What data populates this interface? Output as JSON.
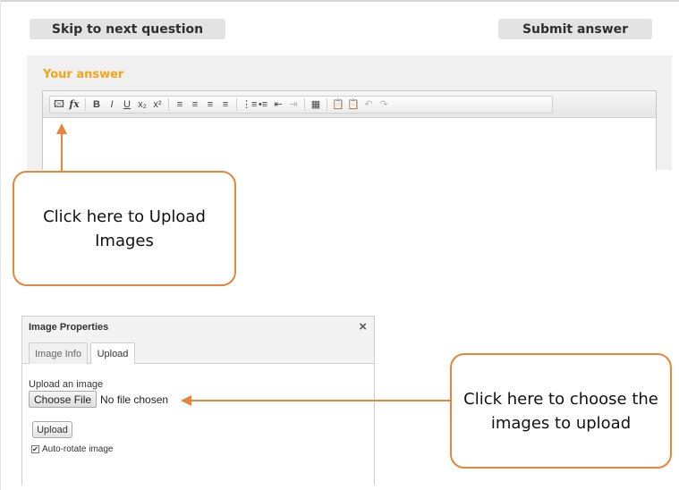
{
  "actions": {
    "skip_label": "Skip to next question",
    "submit_label": "Submit answer"
  },
  "answer": {
    "label": "Your answer"
  },
  "toolbar": {
    "buttons": {
      "image": "🖾",
      "formula": "fx",
      "bold": "B",
      "italic": "I",
      "underline": "U",
      "subscript": "x₂",
      "superscript": "x²",
      "align_left": "≡",
      "align_center": "≡",
      "align_right": "≡",
      "justify": "≡",
      "numbered_list": "⋮≡",
      "bulleted_list": "•≡",
      "outdent": "⇤",
      "indent": "⇥",
      "table": "▦",
      "paste": "📋",
      "paste_text": "📋",
      "undo": "↶",
      "redo": "↷"
    }
  },
  "callouts": {
    "upload_images": "Click here to Upload Images",
    "choose_images": "Click here to choose the images to upload"
  },
  "dialog": {
    "title": "Image Properties",
    "close": "×",
    "tabs": [
      "Image Info",
      "Upload"
    ],
    "upload_label": "Upload an image",
    "choose_file": "Choose File",
    "file_status": "No file chosen",
    "upload_button": "Upload",
    "auto_rotate": "Auto-rotate image",
    "auto_rotate_checked": true
  },
  "colors": {
    "accent_orange": "#e5863a",
    "answer_label": "#f2a51a",
    "button_gray": "#e3e3e3"
  }
}
